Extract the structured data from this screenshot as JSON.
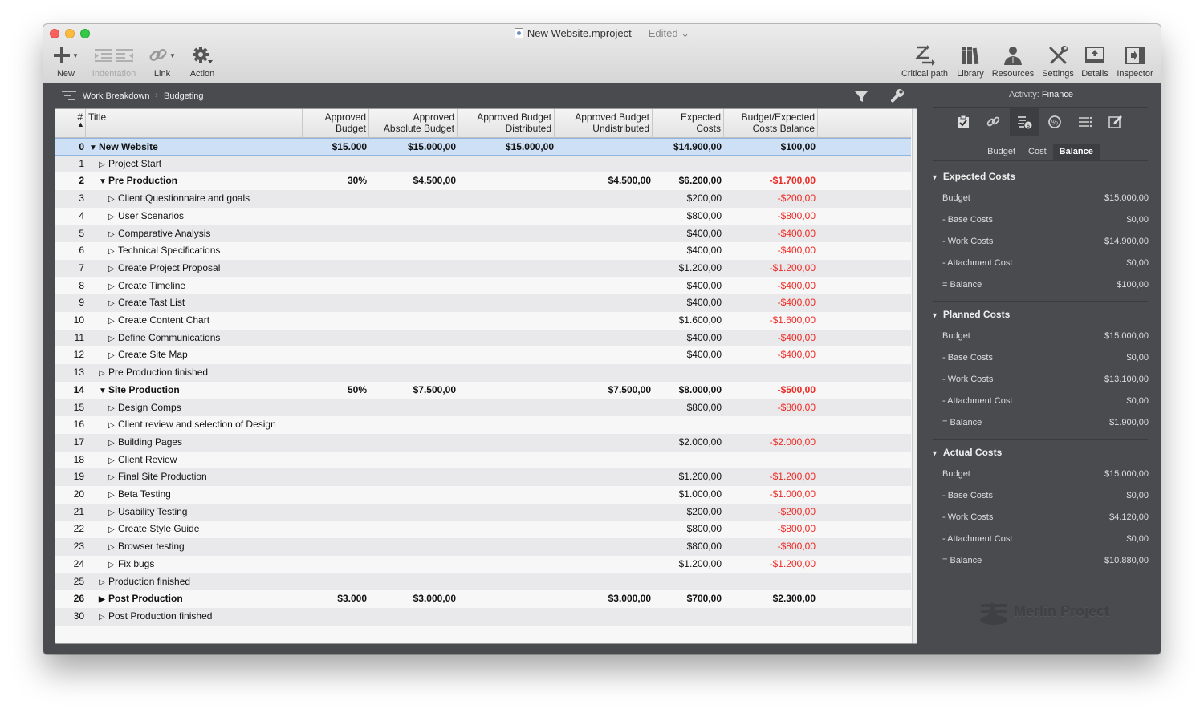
{
  "window": {
    "title": "New Website.mproject",
    "dash": "—",
    "status": "Edited",
    "status_caret": "⌄"
  },
  "toolbar": {
    "left": [
      {
        "id": "new",
        "label": "New",
        "icon": "plus-icon"
      },
      {
        "id": "indentation",
        "label": "Indentation",
        "icon": "indent-outdent-icon",
        "disabled": true
      },
      {
        "id": "link",
        "label": "Link",
        "icon": "link-icon"
      },
      {
        "id": "action",
        "label": "Action",
        "icon": "gear-icon"
      }
    ],
    "right": [
      {
        "id": "critical-path",
        "label": "Critical path",
        "icon": "critical-path-icon"
      },
      {
        "id": "library",
        "label": "Library",
        "icon": "library-icon"
      },
      {
        "id": "resources",
        "label": "Resources",
        "icon": "person-icon"
      },
      {
        "id": "settings",
        "label": "Settings",
        "icon": "tools-icon"
      },
      {
        "id": "details",
        "label": "Details",
        "icon": "details-icon"
      },
      {
        "id": "inspector",
        "label": "Inspector",
        "icon": "inspector-icon"
      }
    ]
  },
  "breadcrumb": {
    "items": [
      "Work Breakdown",
      "Budgeting"
    ],
    "separator": "›"
  },
  "table": {
    "columns": {
      "id": "#",
      "title": "Title",
      "approved_budget": [
        "Approved",
        "Budget"
      ],
      "approved_absolute_budget": [
        "Approved",
        "Absolute Budget"
      ],
      "approved_budget_distributed": [
        "Approved Budget",
        "Distributed"
      ],
      "approved_budget_undistributed": [
        "Approved Budget",
        "Undistributed"
      ],
      "expected_costs": [
        "Expected",
        "Costs"
      ],
      "balance": [
        "Budget/Expected",
        "Costs Balance"
      ]
    },
    "sort_indicator": "▲",
    "rows": [
      {
        "id": "0",
        "title": "New Website",
        "level": 0,
        "bold": true,
        "expanded": true,
        "group": true,
        "selected": true,
        "ab": "$15.000",
        "aab": "$15.000,00",
        "abd": "$15.000,00",
        "abu": "",
        "ec": "$14.900,00",
        "bal": "$100,00",
        "neg": false
      },
      {
        "id": "1",
        "title": "Project Start",
        "level": 1,
        "ab": "",
        "aab": "",
        "abd": "",
        "abu": "",
        "ec": "",
        "bal": "",
        "neg": false
      },
      {
        "id": "2",
        "title": "Pre Production",
        "level": 1,
        "bold": true,
        "expanded": true,
        "group": true,
        "ab": "30%",
        "aab": "$4.500,00",
        "abd": "",
        "abu": "$4.500,00",
        "ec": "$6.200,00",
        "bal": "-$1.700,00",
        "neg": true
      },
      {
        "id": "3",
        "title": "Client Questionnaire and goals",
        "level": 2,
        "ab": "",
        "aab": "",
        "abd": "",
        "abu": "",
        "ec": "$200,00",
        "bal": "-$200,00",
        "neg": true
      },
      {
        "id": "4",
        "title": "User Scenarios",
        "level": 2,
        "ab": "",
        "aab": "",
        "abd": "",
        "abu": "",
        "ec": "$800,00",
        "bal": "-$800,00",
        "neg": true
      },
      {
        "id": "5",
        "title": "Comparative Analysis",
        "level": 2,
        "ab": "",
        "aab": "",
        "abd": "",
        "abu": "",
        "ec": "$400,00",
        "bal": "-$400,00",
        "neg": true
      },
      {
        "id": "6",
        "title": "Technical Specifications",
        "level": 2,
        "ab": "",
        "aab": "",
        "abd": "",
        "abu": "",
        "ec": "$400,00",
        "bal": "-$400,00",
        "neg": true
      },
      {
        "id": "7",
        "title": "Create Project Proposal",
        "level": 2,
        "ab": "",
        "aab": "",
        "abd": "",
        "abu": "",
        "ec": "$1.200,00",
        "bal": "-$1.200,00",
        "neg": true
      },
      {
        "id": "8",
        "title": "Create Timeline",
        "level": 2,
        "ab": "",
        "aab": "",
        "abd": "",
        "abu": "",
        "ec": "$400,00",
        "bal": "-$400,00",
        "neg": true
      },
      {
        "id": "9",
        "title": "Create Tast List",
        "level": 2,
        "ab": "",
        "aab": "",
        "abd": "",
        "abu": "",
        "ec": "$400,00",
        "bal": "-$400,00",
        "neg": true
      },
      {
        "id": "10",
        "title": "Create Content Chart",
        "level": 2,
        "ab": "",
        "aab": "",
        "abd": "",
        "abu": "",
        "ec": "$1.600,00",
        "bal": "-$1.600,00",
        "neg": true
      },
      {
        "id": "11",
        "title": "Define Communications",
        "level": 2,
        "ab": "",
        "aab": "",
        "abd": "",
        "abu": "",
        "ec": "$400,00",
        "bal": "-$400,00",
        "neg": true
      },
      {
        "id": "12",
        "title": "Create Site Map",
        "level": 2,
        "ab": "",
        "aab": "",
        "abd": "",
        "abu": "",
        "ec": "$400,00",
        "bal": "-$400,00",
        "neg": true
      },
      {
        "id": "13",
        "title": "Pre Production finished",
        "level": 1,
        "ab": "",
        "aab": "",
        "abd": "",
        "abu": "",
        "ec": "",
        "bal": "",
        "neg": false
      },
      {
        "id": "14",
        "title": "Site Production",
        "level": 1,
        "bold": true,
        "expanded": true,
        "group": true,
        "ab": "50%",
        "aab": "$7.500,00",
        "abd": "",
        "abu": "$7.500,00",
        "ec": "$8.000,00",
        "bal": "-$500,00",
        "neg": true
      },
      {
        "id": "15",
        "title": "Design Comps",
        "level": 2,
        "ab": "",
        "aab": "",
        "abd": "",
        "abu": "",
        "ec": "$800,00",
        "bal": "-$800,00",
        "neg": true
      },
      {
        "id": "16",
        "title": "Client review and selection of Design",
        "level": 2,
        "ab": "",
        "aab": "",
        "abd": "",
        "abu": "",
        "ec": "",
        "bal": "",
        "neg": false
      },
      {
        "id": "17",
        "title": "Building Pages",
        "level": 2,
        "ab": "",
        "aab": "",
        "abd": "",
        "abu": "",
        "ec": "$2.000,00",
        "bal": "-$2.000,00",
        "neg": true
      },
      {
        "id": "18",
        "title": "Client Review",
        "level": 2,
        "ab": "",
        "aab": "",
        "abd": "",
        "abu": "",
        "ec": "",
        "bal": "",
        "neg": false
      },
      {
        "id": "19",
        "title": "Final Site Production",
        "level": 2,
        "ab": "",
        "aab": "",
        "abd": "",
        "abu": "",
        "ec": "$1.200,00",
        "bal": "-$1.200,00",
        "neg": true
      },
      {
        "id": "20",
        "title": "Beta Testing",
        "level": 2,
        "ab": "",
        "aab": "",
        "abd": "",
        "abu": "",
        "ec": "$1.000,00",
        "bal": "-$1.000,00",
        "neg": true
      },
      {
        "id": "21",
        "title": "Usability Testing",
        "level": 2,
        "ab": "",
        "aab": "",
        "abd": "",
        "abu": "",
        "ec": "$200,00",
        "bal": "-$200,00",
        "neg": true
      },
      {
        "id": "22",
        "title": "Create Style Guide",
        "level": 2,
        "ab": "",
        "aab": "",
        "abd": "",
        "abu": "",
        "ec": "$800,00",
        "bal": "-$800,00",
        "neg": true
      },
      {
        "id": "23",
        "title": "Browser testing",
        "level": 2,
        "ab": "",
        "aab": "",
        "abd": "",
        "abu": "",
        "ec": "$800,00",
        "bal": "-$800,00",
        "neg": true
      },
      {
        "id": "24",
        "title": "Fix bugs",
        "level": 2,
        "ab": "",
        "aab": "",
        "abd": "",
        "abu": "",
        "ec": "$1.200,00",
        "bal": "-$1.200,00",
        "neg": true
      },
      {
        "id": "25",
        "title": "Production finished",
        "level": 1,
        "ab": "",
        "aab": "",
        "abd": "",
        "abu": "",
        "ec": "",
        "bal": "",
        "neg": false
      },
      {
        "id": "26",
        "title": "Post Production",
        "level": 1,
        "bold": true,
        "expanded": false,
        "group": true,
        "ab": "$3.000",
        "aab": "$3.000,00",
        "abd": "",
        "abu": "$3.000,00",
        "ec": "$700,00",
        "bal": "$2.300,00",
        "neg": false
      },
      {
        "id": "30",
        "title": "Post Production finished",
        "level": 1,
        "ab": "",
        "aab": "",
        "abd": "",
        "abu": "",
        "ec": "",
        "bal": "",
        "neg": false
      }
    ]
  },
  "inspector": {
    "title_prefix": "Activity:",
    "title_value": "Finance",
    "tabs": [
      "checklist-icon",
      "link-icon",
      "finance-icon",
      "percent-icon",
      "list-icon",
      "edit-icon"
    ],
    "active_tab": 2,
    "segments": [
      "Budget",
      "Cost",
      "Balance"
    ],
    "active_segment": 2,
    "sections": [
      {
        "title": "Expected Costs",
        "rows": [
          {
            "k": "Budget",
            "v": "$15.000,00"
          },
          {
            "k": "- Base Costs",
            "v": "$0,00"
          },
          {
            "k": "- Work Costs",
            "v": "$14.900,00"
          },
          {
            "k": "- Attachment Cost",
            "v": "$0,00"
          },
          {
            "k": "= Balance",
            "v": "$100,00"
          }
        ]
      },
      {
        "title": "Planned Costs",
        "rows": [
          {
            "k": "Budget",
            "v": "$15.000,00"
          },
          {
            "k": "- Base Costs",
            "v": "$0,00"
          },
          {
            "k": "- Work Costs",
            "v": "$13.100,00"
          },
          {
            "k": "- Attachment Cost",
            "v": "$0,00"
          },
          {
            "k": "= Balance",
            "v": "$1.900,00"
          }
        ]
      },
      {
        "title": "Actual Costs",
        "rows": [
          {
            "k": "Budget",
            "v": "$15.000,00"
          },
          {
            "k": "- Base Costs",
            "v": "$0,00"
          },
          {
            "k": "- Work Costs",
            "v": "$4.120,00"
          },
          {
            "k": "- Attachment Cost",
            "v": "$0,00"
          },
          {
            "k": "= Balance",
            "v": "$10.880,00"
          }
        ]
      }
    ],
    "logo_text": "Merlin Project"
  },
  "colors": {
    "negative": "#ee2a24",
    "selection": "#cde0f6",
    "panel_bg": "#4a4b4f"
  }
}
